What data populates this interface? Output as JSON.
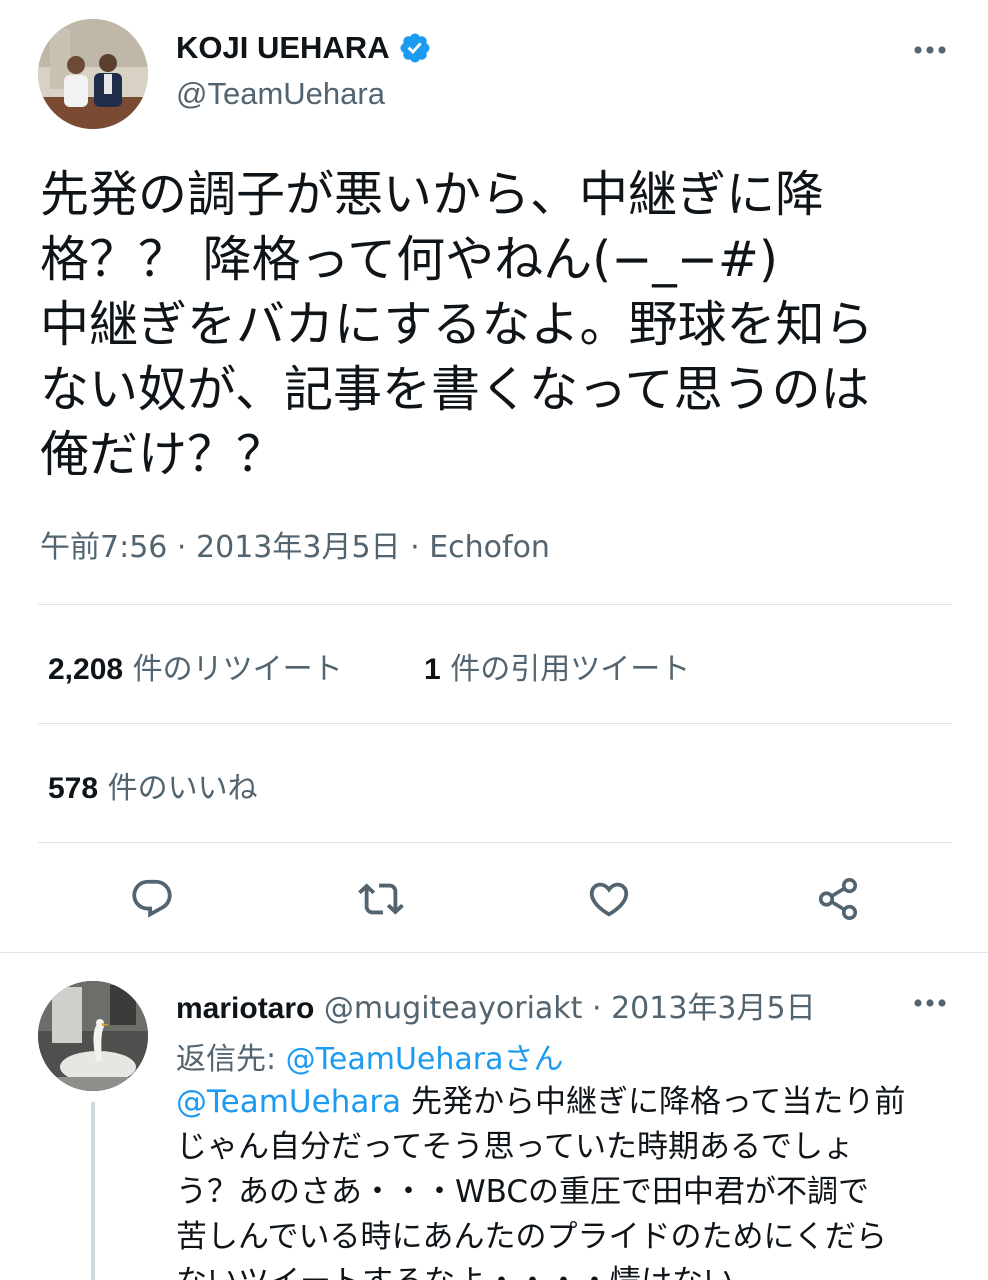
{
  "tweet": {
    "author": {
      "name": "KOJI UEHARA",
      "handle": "@TeamUehara",
      "verified": true
    },
    "text_lines": [
      "先発の調子が悪いから、中継ぎに降",
      "格？？ 降格って何やねん(−_−#)",
      "中継ぎをバカにするなよ。野球を知ら",
      "ない奴が、記事を書くなって思うのは",
      "俺だけ？？"
    ],
    "meta": {
      "time": "午前7:56",
      "date": "2013年3月5日",
      "client": "Echofon",
      "separator": "·"
    },
    "stats": {
      "retweets_count": "2,208",
      "retweets_label": "件のリツイート",
      "quotes_count": "1",
      "quotes_label": "件の引用ツイート",
      "likes_count": "578",
      "likes_label": "件のいいね"
    },
    "actions": [
      {
        "name": "reply",
        "icon": "reply-icon"
      },
      {
        "name": "retweet",
        "icon": "retweet-icon"
      },
      {
        "name": "like",
        "icon": "heart-icon"
      },
      {
        "name": "share",
        "icon": "share-icon"
      }
    ]
  },
  "reply": {
    "author_name": "mariotaro",
    "author_handle": "@mugiteayoriakt",
    "separator": "·",
    "date": "2013年3月5日",
    "replying_to_label": "返信先:",
    "replying_to_handle": "@TeamUehara",
    "replying_to_suffix": "さん",
    "mention": "@TeamUehara",
    "text_lines": [
      " 先発から中継ぎに降格って当たり前",
      "じゃん自分だってそう思っていた時期あるでしょ",
      "う？あのさあ・・・WBCの重圧で田中君が不調で",
      "苦しんでいる時にあんたのプライドのためにくだら",
      "ないツイートするなよ・・・・情けない"
    ]
  },
  "colors": {
    "link": "#1d9bf0",
    "secondary_text": "#536471",
    "primary_text": "#0f1419",
    "divider": "#dfe3e6"
  }
}
